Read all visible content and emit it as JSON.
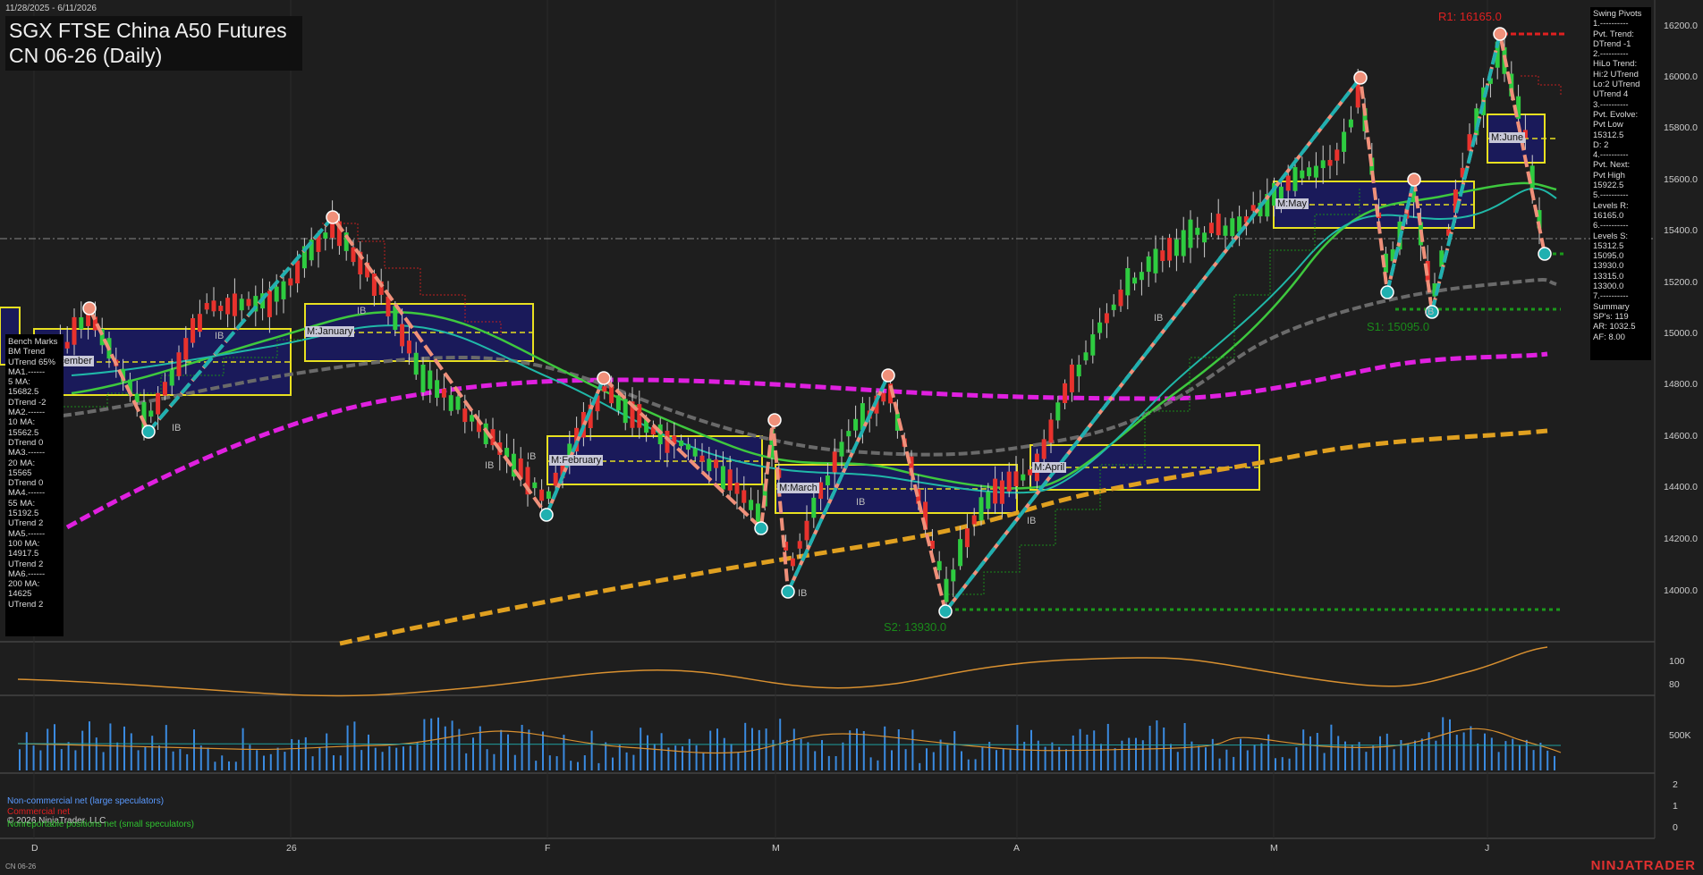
{
  "date_range": "11/28/2025 - 6/11/2026",
  "title": {
    "line1": "SGX FTSE China A50 Futures",
    "line2": "CN 06-26 (Daily)"
  },
  "levels": {
    "r1": "R1: 16165.0",
    "s1": "S1: 15095.0",
    "s2": "S2: 13930.0"
  },
  "swing_pivots": [
    "Swing Pivots",
    "1.----------",
    "Pvt. Trend:",
    "DTrend -1",
    "2.----------",
    "HiLo Trend:",
    "Hi:2 UTrend",
    "Lo:2 UTrend",
    "UTrend 4",
    "3.----------",
    "Pvt. Evolve:",
    "Pvt Low",
    "15312.5",
    "D: 2",
    "4.----------",
    "Pvt. Next:",
    "Pvt High",
    "15922.5",
    "5.----------",
    "Levels R:",
    "16165.0",
    "6.----------",
    "Levels S:",
    "15312.5",
    "15095.0",
    "13930.0",
    "13315.0",
    "13300.0",
    "7.----------",
    "Summary",
    "SP's: 119",
    "AR: 1032.5",
    "AF: 8.00"
  ],
  "bench_marks": [
    "Bench Marks",
    "BM Trend",
    "UTrend 65%",
    "MA1.------",
    "5 MA:",
    "15682.5",
    "DTrend -2",
    "MA2.------",
    "10 MA:",
    "15562.5",
    "DTrend 0",
    "MA3.------",
    "20 MA:",
    "15565",
    "DTrend 0",
    "MA4.------",
    "55 MA:",
    "15192.5",
    "UTrend 2",
    "MA5.------",
    "100 MA:",
    "14917.5",
    "UTrend 2",
    "MA6.------",
    "200 MA:",
    "14625",
    "UTrend 2"
  ],
  "month_tags": [
    "M:December",
    "M:January",
    "M:February",
    "M:March",
    "M:April",
    "M:May",
    "M:June"
  ],
  "ib_label": "IB",
  "y_axis_price": [
    "16200.0",
    "16000.0",
    "15800.0",
    "15600.0",
    "15400.0",
    "15200.0",
    "15000.0",
    "14800.0",
    "14600.0",
    "14400.0",
    "14200.0",
    "14000.0"
  ],
  "y_axis_osc": [
    "100",
    "80"
  ],
  "y_axis_vol": [
    "500K"
  ],
  "y_axis_cot": [
    "2",
    "1",
    "0"
  ],
  "x_axis": [
    "D",
    "26",
    "F",
    "M",
    "A",
    "M",
    "J"
  ],
  "legend": {
    "noncommercial": "Non-commercial net (large speculators)",
    "commercial": "Commercial net",
    "nonreportable": "Nonreportable positions net (small speculators)"
  },
  "copyright": "© 2026 NinjaTrader, LLC",
  "footer_symbol": "CN 06-26",
  "brand": "NINJATRADER",
  "colors": {
    "background": "#1e1e1e",
    "up_candle": "#2ecc40",
    "down_candle": "#e8322d",
    "ma_magenta": "#e020e0",
    "ma_gold": "#e0a020",
    "ma_green": "#40c840",
    "ma_gray": "#808080",
    "swing_up": "#20b0b0",
    "swing_down": "#f0907a"
  }
}
